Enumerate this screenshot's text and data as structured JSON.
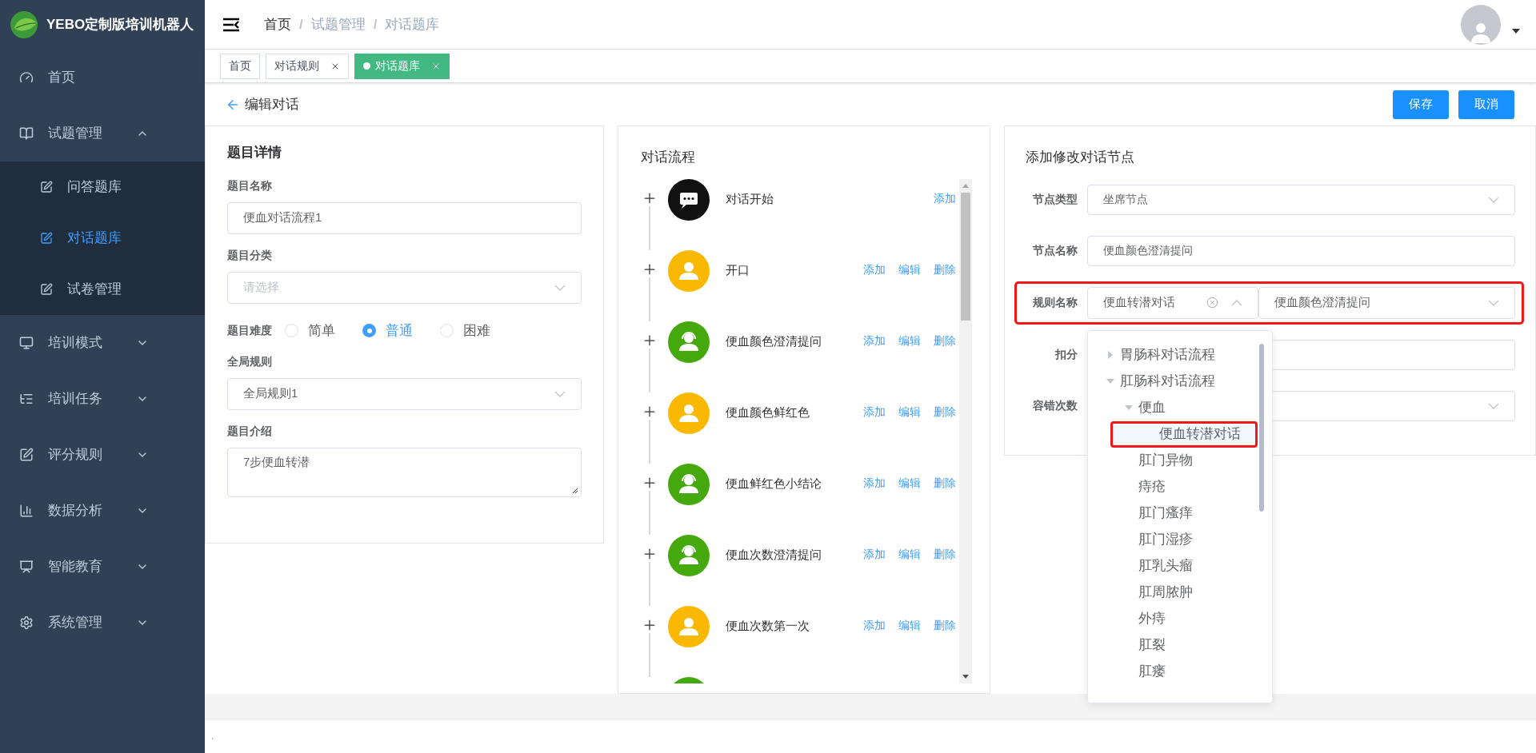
{
  "sidebar": {
    "logo_text": "YEBO定制版培训机器人",
    "items": [
      {
        "kind": "link",
        "label": "首页"
      },
      {
        "kind": "group",
        "label": "试题管理",
        "expanded": true,
        "children": [
          {
            "label": "问答题库",
            "selected": false
          },
          {
            "label": "对话题库",
            "selected": true
          },
          {
            "label": "试卷管理",
            "selected": false
          }
        ]
      },
      {
        "kind": "group",
        "label": "培训模式",
        "expanded": false
      },
      {
        "kind": "group",
        "label": "培训任务",
        "expanded": false
      },
      {
        "kind": "group",
        "label": "评分规则",
        "expanded": false
      },
      {
        "kind": "group",
        "label": "数据分析",
        "expanded": false
      },
      {
        "kind": "group",
        "label": "智能教育",
        "expanded": false
      },
      {
        "kind": "group",
        "label": "系统管理",
        "expanded": false
      }
    ]
  },
  "header": {
    "breadcrumb": {
      "separator": "/",
      "items": [
        "首页",
        "试题管理",
        "对话题库"
      ]
    }
  },
  "tags": [
    {
      "label": "首页",
      "selected": false,
      "closable": false
    },
    {
      "label": "对话规则",
      "selected": false,
      "closable": true
    },
    {
      "label": "对话题库",
      "selected": true,
      "closable": true
    }
  ],
  "page": {
    "title": "编辑对话",
    "buttons": [
      "保存",
      "取消"
    ]
  },
  "details": {
    "title": "题目详情",
    "fields": [
      {
        "kind": "input",
        "label": "题目名称",
        "value": "便血对话流程1"
      },
      {
        "kind": "select",
        "label": "题目分类",
        "placeholder": "请选择"
      },
      {
        "kind": "radio",
        "label": "题目难度",
        "options": [
          {
            "label": "简单",
            "selected": false
          },
          {
            "label": "普通",
            "selected": true
          },
          {
            "label": "困难",
            "selected": false
          }
        ]
      },
      {
        "kind": "select",
        "label": "全局规则",
        "value": "全局规则1"
      },
      {
        "kind": "textarea",
        "label": "题目介绍",
        "value": "7步便血转潜"
      }
    ]
  },
  "flow": {
    "title": "对话流程",
    "nodes": [
      {
        "kind": "start",
        "label": "对话开始",
        "actions": [
          "添加"
        ]
      },
      {
        "kind": "customer",
        "label": "开口",
        "actions": [
          "添加",
          "编辑",
          "删除"
        ]
      },
      {
        "kind": "agent",
        "label": "便血颜色澄清提问",
        "actions": [
          "添加",
          "编辑",
          "删除"
        ]
      },
      {
        "kind": "customer",
        "label": "便血颜色鲜红色",
        "actions": [
          "添加",
          "编辑",
          "删除"
        ]
      },
      {
        "kind": "agent",
        "label": "便血鲜红色小结论",
        "actions": [
          "添加",
          "编辑",
          "删除"
        ]
      },
      {
        "kind": "agent",
        "label": "便血次数澄清提问",
        "actions": [
          "添加",
          "编辑",
          "删除"
        ]
      },
      {
        "kind": "customer",
        "label": "便血次数第一次",
        "actions": [
          "添加",
          "编辑",
          "删除"
        ]
      },
      {
        "kind": "agent"
      }
    ]
  },
  "node_form": {
    "title": "添加修改对话节点",
    "fields": [
      {
        "kind": "select",
        "label": "节点类型",
        "value": "坐席节点",
        "highlighted": false
      },
      {
        "kind": "input",
        "label": "节点名称",
        "value": "便血颜色澄清提问",
        "highlighted": false
      },
      {
        "kind": "cascader",
        "label": "规则名称",
        "value": "便血转潜对话",
        "second_value": "便血颜色澄清提问",
        "highlighted": true,
        "open": true
      },
      {
        "kind": "input",
        "label": "扣分",
        "highlighted": false
      },
      {
        "kind": "select",
        "label": "容错次数",
        "highlighted": false
      }
    ],
    "tree": [
      {
        "label": "胃肠科对话流程",
        "expanded": false,
        "selected": false,
        "highlighted": false
      },
      {
        "label": "肛肠科对话流程",
        "expanded": true,
        "selected": false,
        "highlighted": false,
        "children": [
          {
            "label": "便血",
            "expanded": true,
            "selected": false,
            "highlighted": false,
            "children": [
              {
                "label": "便血转潜对话",
                "selected": true,
                "highlighted": true
              }
            ]
          },
          {
            "label": "肛门异物",
            "selected": false,
            "highlighted": false
          },
          {
            "label": "痔疮",
            "selected": false,
            "highlighted": false
          },
          {
            "label": "肛门瘙痒",
            "selected": false,
            "highlighted": false
          },
          {
            "label": "肛门湿疹",
            "selected": false,
            "highlighted": false
          },
          {
            "label": "肛乳头瘤",
            "selected": false,
            "highlighted": false
          },
          {
            "label": "肛周脓肿",
            "selected": false,
            "highlighted": false
          },
          {
            "label": "外痔",
            "selected": false,
            "highlighted": false
          },
          {
            "label": "肛裂",
            "selected": false,
            "highlighted": false
          },
          {
            "label": "肛瘘",
            "selected": false,
            "highlighted": false
          }
        ]
      }
    ]
  },
  "footer": {
    "text": "."
  }
}
